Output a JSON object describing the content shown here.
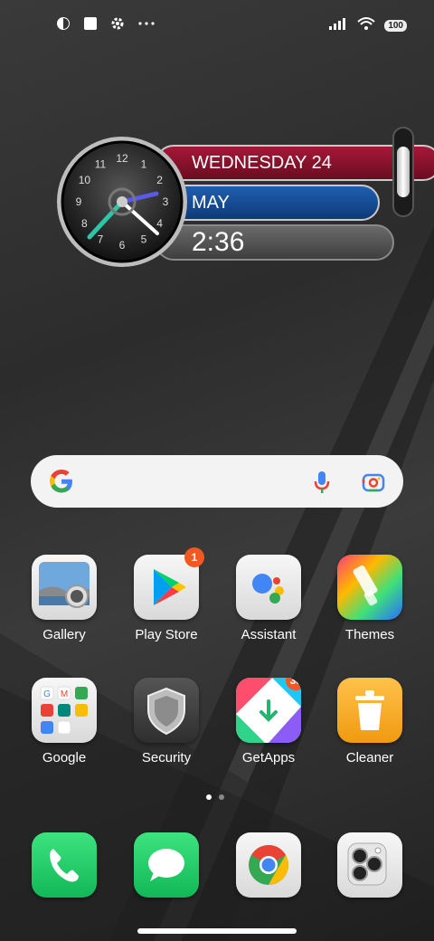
{
  "status_bar": {
    "left_icons": [
      "vpn-icon",
      "square-notification-icon",
      "settings-icon",
      "more-dots-icon"
    ],
    "battery": "100"
  },
  "clock_widget": {
    "day": "WEDNESDAY 24",
    "month": "MAY",
    "time": "2:36",
    "dial_numbers": [
      "12",
      "1",
      "2",
      "3",
      "4",
      "5",
      "6",
      "7",
      "8",
      "9",
      "10",
      "11"
    ]
  },
  "search_bar": {
    "icons": [
      "google-g-icon",
      "microphone-icon",
      "lens-camera-icon"
    ]
  },
  "apps": [
    {
      "label": "Gallery",
      "icon": "gallery-icon"
    },
    {
      "label": "Play Store",
      "icon": "play-store-icon",
      "badge": "1"
    },
    {
      "label": "Assistant",
      "icon": "assistant-icon"
    },
    {
      "label": "Themes",
      "icon": "themes-icon"
    },
    {
      "label": "Google",
      "icon": "google-folder-icon"
    },
    {
      "label": "Security",
      "icon": "security-shield-icon"
    },
    {
      "label": "GetApps",
      "icon": "getapps-icon",
      "badge": "33"
    },
    {
      "label": "Cleaner",
      "icon": "cleaner-trash-icon"
    }
  ],
  "dock": [
    {
      "name": "phone",
      "icon": "phone-icon"
    },
    {
      "name": "messages",
      "icon": "messages-icon"
    },
    {
      "name": "chrome",
      "icon": "chrome-icon"
    },
    {
      "name": "camera",
      "icon": "camera-icon"
    }
  ],
  "page_indicator": {
    "pages": 2,
    "current": 1
  },
  "colors": {
    "badge": "#f05a22",
    "day_pill": "#a51838",
    "month_pill": "#1f5fb0",
    "clock_accent": "#2ec4a6"
  }
}
